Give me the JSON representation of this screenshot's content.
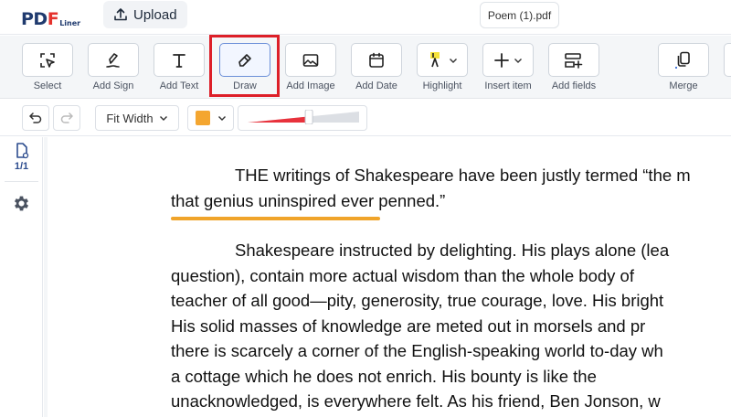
{
  "app": {
    "logo_main_a": "PD",
    "logo_main_b": "F",
    "logo_sub": "Liner",
    "upload_label": "Upload",
    "doc_tab": "Poem (1).pdf"
  },
  "toolbar": {
    "items": [
      {
        "label": "Select",
        "icon": "select-cursor-icon"
      },
      {
        "label": "Add Sign",
        "icon": "signature-pen-icon"
      },
      {
        "label": "Add Text",
        "icon": "text-t-icon"
      },
      {
        "label": "Draw",
        "icon": "pencil-icon",
        "active": true
      },
      {
        "label": "Add Image",
        "icon": "image-icon"
      },
      {
        "label": "Add Date",
        "icon": "calendar-icon"
      },
      {
        "label": "Highlight",
        "icon": "highlighter-icon"
      },
      {
        "label": "Insert item",
        "icon": "plus-icon"
      },
      {
        "label": "Add fields",
        "icon": "form-fields-icon"
      },
      {
        "label": "Merge",
        "icon": "merge-files-icon"
      }
    ]
  },
  "subbar": {
    "zoom_label": "Fit Width",
    "draw_color": "#f4a630",
    "thickness_level": 0.55
  },
  "sidebar": {
    "page_indicator": "1/1"
  },
  "document": {
    "p1_line1": "THE writings of Shakespeare have been justly termed “the m",
    "p1_line2": "that genius uninspired ever penned.”",
    "p2_lines": [
      "Shakespeare instructed by delighting. His plays alone (lea",
      "question), contain more actual wisdom than the whole body of",
      "teacher of all good—pity, generosity, true courage, love. His bright",
      "His solid masses of knowledge are meted out in morsels and pr",
      "there is scarcely a corner of the English-speaking world to-day wh",
      "a cottage which he does not enrich. His bounty is like the",
      "unacknowledged, is everywhere felt. As his friend, Ben Jonson, w"
    ],
    "highlight_color": "#f0a42a"
  }
}
